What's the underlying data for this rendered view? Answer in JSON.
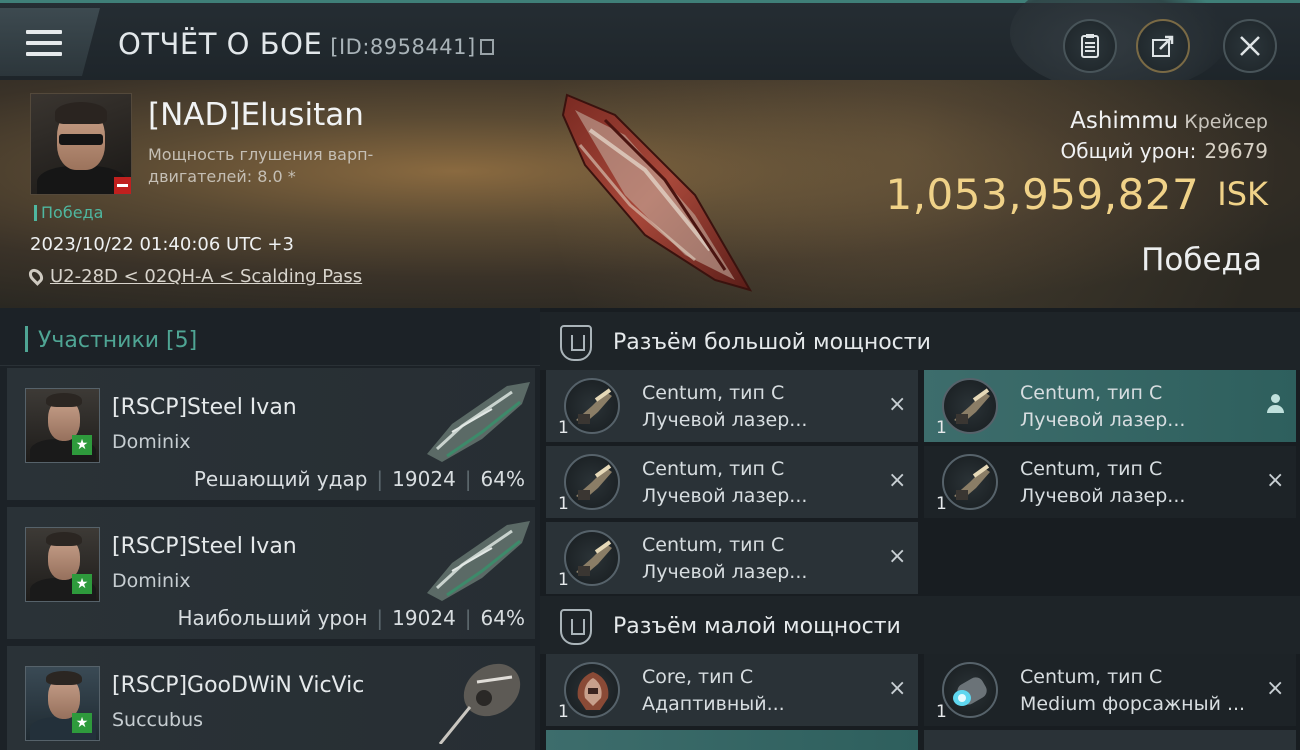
{
  "header": {
    "title": "ОТЧЁТ О БОЕ",
    "report_id": "[ID:8958441]"
  },
  "victim": {
    "name": "[NAD]Elusitan",
    "warp_label": "Мощность глушения варп-двигателей: 8.0 *",
    "status": "Победа",
    "datetime": "2023/10/22 01:40:06 UTC +3",
    "location": "U2-28D < 02QH-A < Scalding Pass",
    "ship_name": "Ashimmu",
    "ship_class": "Крейсер",
    "damage_label": "Общий урон:",
    "damage_value": "29679",
    "isk_value": "1,053,959,827",
    "isk_unit": "ISK",
    "result": "Победа"
  },
  "participants": {
    "header": "Участники [5]",
    "rows": [
      {
        "name": "[RSCP]Steel Ivan",
        "ship": "Dominix",
        "role": "Решающий удар",
        "damage": "19024",
        "percent": "64%"
      },
      {
        "name": "[RSCP]Steel Ivan",
        "ship": "Dominix",
        "role": "Наибольший урон",
        "damage": "19024",
        "percent": "64%"
      },
      {
        "name": "[RSCP]GooDWiN VicVic",
        "ship": "Succubus"
      }
    ]
  },
  "modules": {
    "high_slot_title": "Разъём большой мощности",
    "low_slot_title": "Разъём малой мощности",
    "high": [
      {
        "name": "Centum, тип C",
        "type": "Лучевой лазер...",
        "qty": "1",
        "action": "×"
      },
      {
        "name": "Centum, тип C",
        "type": "Лучевой лазер...",
        "qty": "1",
        "action": "person"
      },
      {
        "name": "Centum, тип C",
        "type": "Лучевой лазер...",
        "qty": "1",
        "action": "×"
      },
      {
        "name": "Centum, тип C",
        "type": "Лучевой лазер...",
        "qty": "1",
        "action": "×"
      },
      {
        "name": "Centum, тип C",
        "type": "Лучевой лазер...",
        "qty": "1",
        "action": "×"
      }
    ],
    "low": [
      {
        "name": "Core, тип C",
        "type": "Адаптивный...",
        "qty": "1",
        "action": "×"
      },
      {
        "name": "Centum, тип C",
        "type": "Medium форсажный ...",
        "qty": "1",
        "action": "×"
      }
    ]
  },
  "colors": {
    "accent_teal": "#4fa594",
    "isk_gold": "#f0d288",
    "badge_red": "#c0201e",
    "badge_green": "#2e9a3c"
  }
}
